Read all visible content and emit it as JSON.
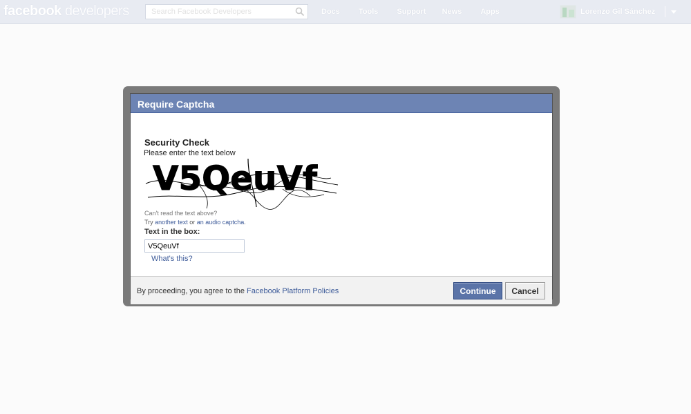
{
  "topbar": {
    "logo_bold": "facebook",
    "logo_light": " developers",
    "search_placeholder": "Search Facebook Developers",
    "nav": [
      "Docs",
      "Tools",
      "Support",
      "News",
      "Apps"
    ],
    "user_name": "Lorenzo Gil Sánchez"
  },
  "dialog": {
    "title": "Require Captcha",
    "security_title": "Security Check",
    "security_sub": "Please enter the text below",
    "captcha_text": "V5QeuVf",
    "cant_read": "Can't read the text above?",
    "try_prefix": "Try ",
    "try_link1": "another text",
    "try_mid": " or ",
    "try_link2": "an audio captcha",
    "try_suffix": ".",
    "box_label": "Text in the box:",
    "answer_value": "V5QeuVf",
    "whats_this": "What's this?",
    "footer_prefix": "By proceeding, you agree to the ",
    "footer_link": "Facebook Platform Policies",
    "continue_label": "Continue",
    "cancel_label": "Cancel"
  },
  "colors": {
    "topbar_bg": "#e8ebf2",
    "header_bg": "#6d84b4",
    "link": "#3b5998",
    "continue_bg": "#5b74a8"
  }
}
